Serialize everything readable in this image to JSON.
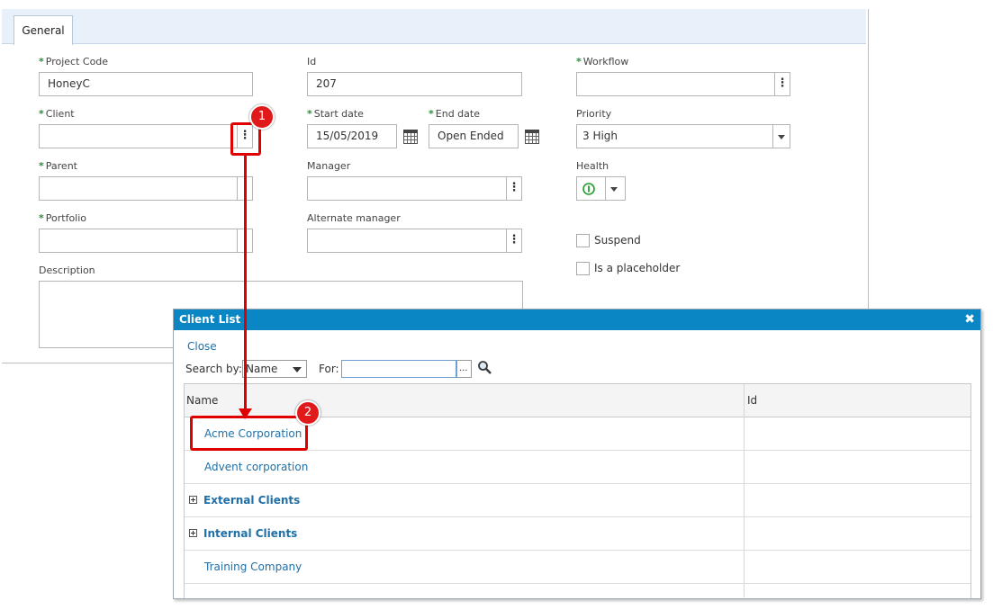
{
  "tabs": [
    {
      "label": "General"
    }
  ],
  "form": {
    "project_code": {
      "label": "Project Code",
      "value": "HoneyC"
    },
    "id": {
      "label": "Id",
      "value": "207"
    },
    "workflow": {
      "label": "Workflow",
      "value": ""
    },
    "client": {
      "label": "Client",
      "value": ""
    },
    "start_date": {
      "label": "Start date",
      "value": "15/05/2019"
    },
    "end_date": {
      "label": "End date",
      "value": "Open Ended"
    },
    "priority": {
      "label": "Priority",
      "value": "3 High"
    },
    "parent": {
      "label": "Parent",
      "value": ""
    },
    "manager": {
      "label": "Manager",
      "value": ""
    },
    "health": {
      "label": "Health"
    },
    "portfolio": {
      "label": "Portfolio",
      "value": ""
    },
    "alternate_manager": {
      "label": "Alternate manager",
      "value": ""
    },
    "suspend": {
      "label": "Suspend"
    },
    "placeholder": {
      "label": "Is a placeholder"
    },
    "description": {
      "label": "Description"
    },
    "required_mark": "*"
  },
  "annotations": {
    "step1": "1",
    "step2": "2"
  },
  "dialog": {
    "title": "Client List",
    "close_x": "✖",
    "close_link": "Close",
    "search_by_label": "Search by:",
    "search_by_value": "Name",
    "for_label": "For:",
    "for_value": "",
    "ellipsis": "...",
    "columns": {
      "name": "Name",
      "id": "Id"
    },
    "rows": [
      {
        "name": "Acme Corporation",
        "id": "",
        "group": false
      },
      {
        "name": "Advent corporation",
        "id": "",
        "group": false
      },
      {
        "name": "External Clients",
        "id": "",
        "group": true
      },
      {
        "name": "Internal Clients",
        "id": "",
        "group": true
      },
      {
        "name": "Training Company",
        "id": "",
        "group": false
      }
    ]
  },
  "colors": {
    "accent": "#0a86c4",
    "annotation": "#e00000",
    "required": "#2e8b3e",
    "link": "#1f6fa8"
  }
}
